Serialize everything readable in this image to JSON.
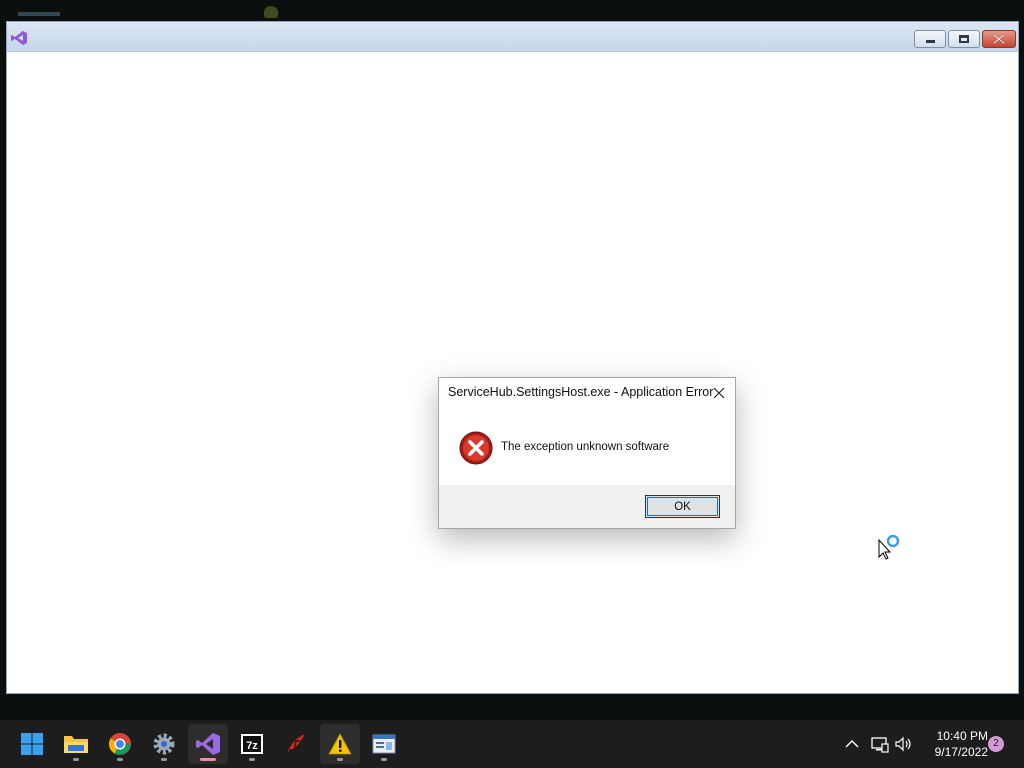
{
  "dialog": {
    "title": "ServiceHub.SettingsHost.exe - Application Error",
    "message": "The exception unknown software",
    "ok_label": "OK"
  },
  "taskbar": {
    "apps": [
      {
        "name": "start-button",
        "icon": "windows-logo-icon"
      },
      {
        "name": "file-explorer",
        "icon": "folder-icon"
      },
      {
        "name": "chrome",
        "icon": "chrome-icon"
      },
      {
        "name": "settings",
        "icon": "gear-icon"
      },
      {
        "name": "visual-studio",
        "icon": "visual-studio-icon",
        "active": true
      },
      {
        "name": "7zip",
        "icon": "7zip-icon",
        "label": "7z"
      },
      {
        "name": "tcl",
        "icon": "tcl-feather-icon"
      },
      {
        "name": "warning-app",
        "icon": "warning-icon"
      },
      {
        "name": "notepad-window",
        "icon": "window-app-icon"
      }
    ],
    "clock": {
      "time": "10:40 PM",
      "date": "9/17/2022"
    },
    "notification_count": "2"
  },
  "colors": {
    "error_red": "#c42b1c",
    "accent_blue": "#0078d7",
    "taskbar_bg": "#1d1d1d"
  }
}
